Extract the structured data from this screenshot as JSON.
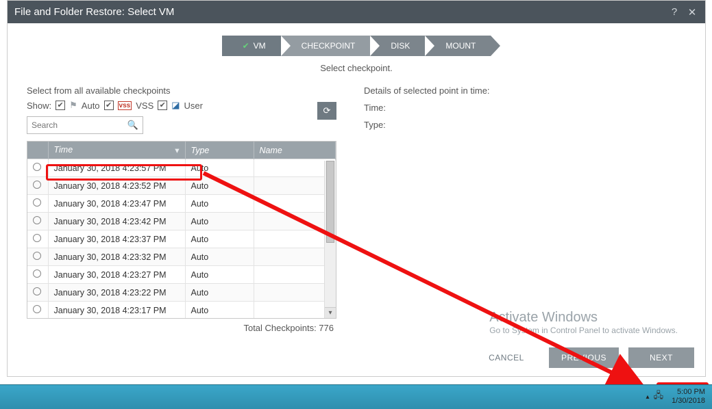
{
  "dialog": {
    "title": "File and Folder Restore: Select VM",
    "subtitle": "Select checkpoint.",
    "steps": [
      "VM",
      "CHECKPOINT",
      "DISK",
      "MOUNT"
    ],
    "left": {
      "heading": "Select from all available checkpoints",
      "show_label": "Show:",
      "filters": [
        "Auto",
        "VSS",
        "User"
      ],
      "search_placeholder": "Search",
      "columns": [
        "",
        "Time",
        "Type",
        "Name"
      ],
      "rows": [
        {
          "time": "January 30, 2018 4:23:57 PM",
          "type": "Auto",
          "name": ""
        },
        {
          "time": "January 30, 2018 4:23:52 PM",
          "type": "Auto",
          "name": ""
        },
        {
          "time": "January 30, 2018 4:23:47 PM",
          "type": "Auto",
          "name": ""
        },
        {
          "time": "January 30, 2018 4:23:42 PM",
          "type": "Auto",
          "name": ""
        },
        {
          "time": "January 30, 2018 4:23:37 PM",
          "type": "Auto",
          "name": ""
        },
        {
          "time": "January 30, 2018 4:23:32 PM",
          "type": "Auto",
          "name": ""
        },
        {
          "time": "January 30, 2018 4:23:27 PM",
          "type": "Auto",
          "name": ""
        },
        {
          "time": "January 30, 2018 4:23:22 PM",
          "type": "Auto",
          "name": ""
        },
        {
          "time": "January 30, 2018 4:23:17 PM",
          "type": "Auto",
          "name": ""
        }
      ],
      "total": "Total Checkpoints: 776"
    },
    "right": {
      "heading": "Details of selected point in time:",
      "time_label": "Time:",
      "type_label": "Type:"
    },
    "watermark": {
      "l1": "Activate Windows",
      "l2": "Go to System in Control Panel to activate Windows."
    },
    "buttons": {
      "cancel": "CANCEL",
      "prev": "PREVIOUS",
      "next": "NEXT"
    }
  },
  "tray": {
    "time": "5:00 PM",
    "date": "1/30/2018"
  }
}
